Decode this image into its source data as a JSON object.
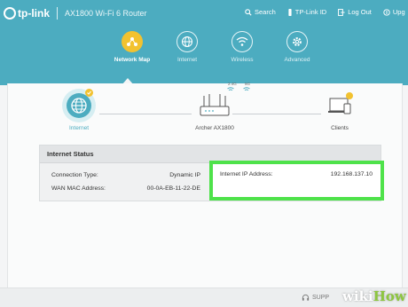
{
  "header": {
    "brand": "tp-link",
    "model": "AX1800 Wi-Fi 6 Router",
    "links": [
      {
        "label": "Search",
        "icon": "search-icon"
      },
      {
        "label": "TP-Link ID",
        "icon": "id-icon"
      },
      {
        "label": "Log Out",
        "icon": "logout-icon"
      },
      {
        "label": "Upg",
        "icon": "upgrade-icon"
      }
    ]
  },
  "nav": {
    "tabs": [
      {
        "label": "Network Map",
        "icon": "network-map-icon",
        "active": true
      },
      {
        "label": "Internet",
        "icon": "globe-icon"
      },
      {
        "label": "Wireless",
        "icon": "wifi-icon"
      },
      {
        "label": "Advanced",
        "icon": "gear-icon"
      }
    ]
  },
  "topology": {
    "internet_label": "Internet",
    "router_label": "Archer AX1800",
    "clients_label": "Clients",
    "band_24": "2.4G",
    "band_5": "5G"
  },
  "status": {
    "title": "Internet Status",
    "connection_type_label": "Connection Type:",
    "connection_type_value": "Dynamic IP",
    "wan_mac_label": "WAN MAC Address:",
    "wan_mac_value": "00-0A-EB-11-22-DE",
    "ip_label": "Internet IP Address:",
    "ip_value": "192.168.137.10"
  },
  "footer": {
    "support": "SUPP"
  },
  "watermark": {
    "wiki": "wiki",
    "how": "How"
  },
  "colors": {
    "header_bg": "#4cacc0",
    "accent_yellow": "#f2c230",
    "highlight_green": "#4ee24a"
  }
}
